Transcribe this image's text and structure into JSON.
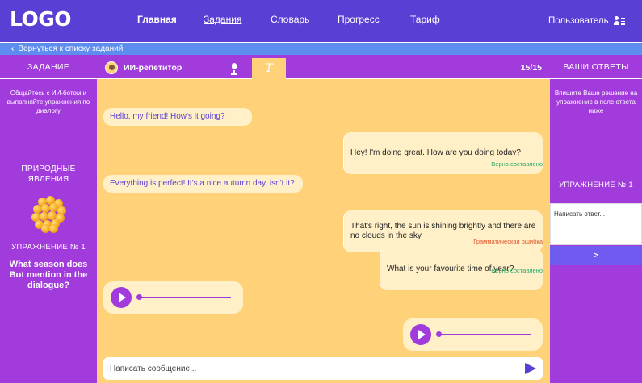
{
  "header": {
    "logo": "LOGO",
    "nav": [
      "Главная",
      "Задания",
      "Словарь",
      "Прогресс",
      "Тариф"
    ],
    "active_nav": "Задания",
    "user": "Пользователь",
    "user_icon": "user-list-icon"
  },
  "backbar": {
    "label": "Вернуться к списку заданий",
    "icon": "chevron-left-icon"
  },
  "left": {
    "title": "ЗАДАНИЕ",
    "intro": "Общайтесь с ИИ-ботом и выполняйте упражнения по диалогу",
    "topic": "ПРИРОДНЫЕ ЯВЛЕНИЯ",
    "exercise": "УПРАЖНЕНИЕ № 1",
    "question": "What season does Bot mention in the dialogue?"
  },
  "chat_header": {
    "bot_name": "ИИ-репетитор",
    "text_tab": "T",
    "counter": "15/15"
  },
  "messages": [
    {
      "from": "bot",
      "text": "Hello, my friend! How's it going?"
    },
    {
      "from": "user",
      "text": "Hey! I'm doing great.  How are you doing today?",
      "status": "Верно составлено",
      "status_type": "ok"
    },
    {
      "from": "bot",
      "text": "Everything is perfect! It's a nice autumn day, isn't it?"
    },
    {
      "from": "user",
      "text": "That's right, the sun is shining brightly and there are no clouds in the sky.",
      "status": "Грамматическая ошибка",
      "status_type": "error"
    },
    {
      "from": "user",
      "text": "What is your favourite time of year?",
      "status": "Верно составлено",
      "status_type": "ok"
    },
    {
      "from": "bot",
      "type": "audio",
      "progress": 0
    },
    {
      "from": "user",
      "type": "audio",
      "progress": 0
    }
  ],
  "chat_input": {
    "placeholder": "Написать сообщение..."
  },
  "right": {
    "title": "ВАШИ ОТВЕТЫ",
    "intro": "Впишите Ваше решение на упражнение в поле ответа ниже",
    "exercise": "УПРАЖНЕНИЕ № 1",
    "answer_placeholder": "Написать ответ...",
    "submit": ">"
  },
  "colors": {
    "header": "#5B3FD4",
    "backbar": "#5E8DF0",
    "panel": "#A23BDC",
    "chat_bg": "#FFD27A",
    "bubble": "#FFF0C8",
    "ok": "#2AA865",
    "error": "#E2552A"
  }
}
